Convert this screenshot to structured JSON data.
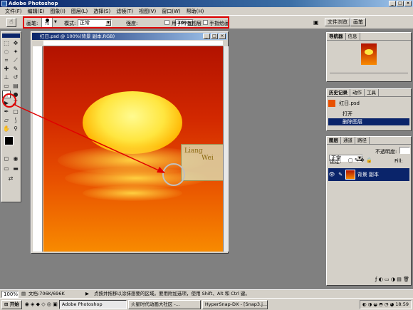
{
  "app": {
    "title": "Adobe Photoshop"
  },
  "menu": [
    "文件(F)",
    "编辑(E)",
    "图象(I)",
    "图层(L)",
    "选择(S)",
    "滤镜(T)",
    "视图(V)",
    "窗口(W)",
    "帮助(H)"
  ],
  "options": {
    "brush_label": "画笔:",
    "brush_size": "75",
    "mode_label": "模式:",
    "mode_value": "正常",
    "strength_label": "强度:",
    "strength_value": "36%",
    "all_layers_label": "用于所有图层",
    "finger_paint_label": "手指绘画"
  },
  "top_right_tabs": [
    "文件浏览",
    "画笔"
  ],
  "document": {
    "title": "红日.psd @ 100%(背景 副本,RGB)"
  },
  "watermark": {
    "line1": "Liang",
    "line2": "Wei"
  },
  "navigator": {
    "tabs": [
      "导航器",
      "信息"
    ]
  },
  "history": {
    "tabs": [
      "历史记录",
      "动作",
      "工具"
    ],
    "snapshot": "红日.psd",
    "items": [
      "打开",
      "删除图层"
    ]
  },
  "layers": {
    "tabs": [
      "图层",
      "通道",
      "路径"
    ],
    "blend_mode": "正常",
    "opacity_label": "不透明度:",
    "lock_label": "锁定:",
    "fill_label": "Fill:",
    "layer_name": "背景 副本"
  },
  "status": {
    "zoom": "100%",
    "doc_info": "文档:706K/696K",
    "hint": "点按并拖移以涂抹想要的区域。要用附加选项，使用 Shift、Alt 和 Ctrl 键。"
  },
  "taskbar": {
    "start": "开始",
    "items": [
      "Adobe Photoshop",
      "火星时代动画大社区 -...",
      "HyperSnap-DX - [Snap3.j..."
    ],
    "clock": "18:59"
  },
  "colors": {
    "accent": "#0a246a",
    "highlight": "#e00000"
  }
}
